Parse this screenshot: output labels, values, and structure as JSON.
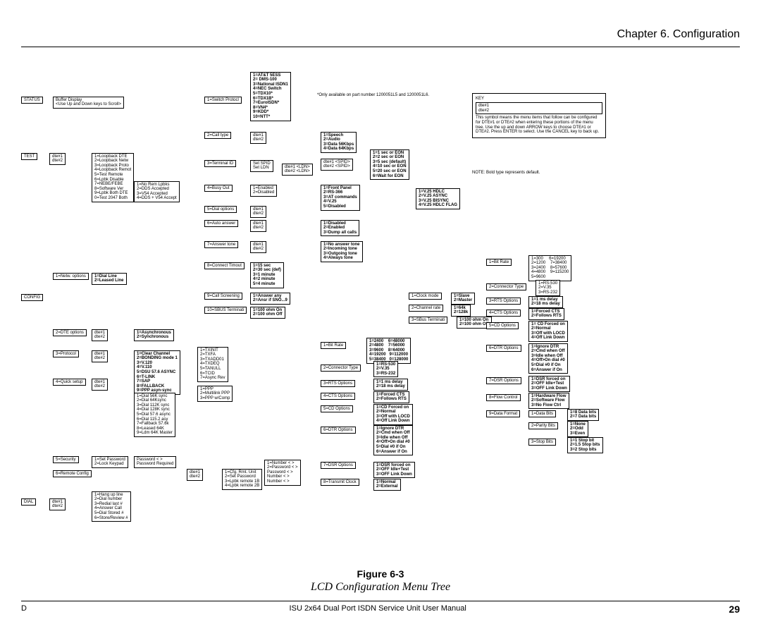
{
  "chapter": "Chapter 6. Configuration",
  "figure_label": "Figure 6-3",
  "figure_caption": "LCD Configuration Menu Tree",
  "footer_left": "D",
  "footer_mid": "ISU 2x64 Dual Port ISDN Service Unit User Manual",
  "page_num": "29",
  "key_title": "KEY",
  "key_dte1": "dte#1",
  "key_dte2": "dte#2",
  "key_text": "This symbol means the menu items that follow can be configured for DTE#1 or DTE#2 when entering these portions of the menu tree. Use the up and down ARROW keys to choose DTE#1 or DTE#2. Press ENTER to select. Use the CANCEL key to back up.",
  "note_bold": "NOTE: Bold type represents default.",
  "star_note": "*Only available on part number 1200051L5 and 1200051L6.",
  "status": "STATUS",
  "status_buffer": "Buffer Display\n<Use Up and Down keys to Scroll>",
  "test": "TEST",
  "test_dte": "dte#1\ndte#2",
  "test_loop": "1=Loopback DTE\n2=Loopback Netw\n3=Loopback Proto\n4=Loopback Remot\n5=Test Remote\n6=Lpbk Disable\n7=NEBE/FEBE\n8=Software Ver\n9=Lpbk Both DTE\n0=Test 2047 Both",
  "test_rem": "1=No Rem Lpbks\n2=DDS Accepted\n3=V54 Accepted\n4=DDS + V54 Accept",
  "config": "CONFIG",
  "netw_opt": "1=Netw. options",
  "netw_line": "1=Dial Line\n2=Leased Line",
  "sw_protocol": "1=Switch Protocl",
  "sw_list": "1=AT&T 5ESS\n2= DMS-100\n3=National ISDN1\n4=NEC Switch\n5=TDX10*\n6=TDX1B*\n7=EuroISDN*\n8=VN4*\n9=KDD*\n10=NTT*",
  "call_type": "2=Call type",
  "call_dte": "dte#1\ndte#2",
  "call_list": "1=Speech\n2=Audio\n3=Data 56Kbps\n4=Data 64Kbps",
  "eon": "1=1 sec or EON\n2=2 sec or EON\n3=5 sec (default)\n4=10 sec or EON\n5=20 sec or EON\n6=Wait for EON",
  "term_id": "3=Terminal ID",
  "term_spid": "Set SPID\nSet LDN",
  "term_dte": "dte#1 <LDN>\ndte#2 <LDN>",
  "term_spid2": "dte#1 <SPID>\ndte#2 <SPID>",
  "busy": "4=Busy Out",
  "busy_list": "1=Enabled\n2=Disabled",
  "front": "1=Front Panel\n2=RS-366\n3=AT commands\n4=V.25\n5=Disabled",
  "hdlc": "1=V.25 HDLC\n2=V.25 ASYNC\n3=V.25 BISYNC\n4=V.25 HDLC FLAG",
  "dial_opt": "5=Dial options",
  "dial_dte": "dte#1\ndte#2",
  "auto_ans": "6=Auto answer",
  "auto_dte": "dte#1\ndte#2",
  "auto_list": "1=Disabled\n2=Enabled\n3=Dump all calls",
  "ans_tone": "7=Answer tone",
  "ans_dte": "dte#1\ndte#2",
  "ans_list": "1=No answer tone\n2=Incoming tone\n3=Outgoing tone\n4=Always tone",
  "conn_to": "8=Connect Timout",
  "conn_list": "1=15 sec\n2=30 sec (def)\n3=1 minute\n4=2 minute\n5=4 minute",
  "call_scr": "9=Call Screening",
  "call_scr_list": "1=Answer any\n2=Ansr if SNO...9",
  "sbus": "10=SBUS Terminati",
  "sbus_list": "1=100 ohm On\n2=100 ohm Off",
  "clock_mode": "1=Clock mode",
  "clock_list": "1=Slave\n2=Master",
  "chan_rate": "2=Channel rate",
  "chan_list": "1=64k\n2=128k",
  "sbus_term": "3=SBus Terminati",
  "sbus_term_list": "1=100 ohm On\n2=100 ohm Off",
  "dte_opt": "2=DTE options",
  "dte_dte": "dte#1\ndte#2",
  "sync": "1=Asynchronous\n2=Synchronous",
  "protocol": "3=Protocol",
  "proto_dte": "dte#1\ndte#2",
  "proto_list": "1=Clear Channel\n2=BONDING mode 1\n3=V.120\n4=V.110\n5=DSU 57.6 ASYNC\n6=T-LINK\n7=SAP\n8=FALLBACK\n9=PPP asyn-sync",
  "proto_tx": "1=TXINIT\n2=TXFA\n3=TXADD01\n4=TXDEQ\n5=TANULL\n6=TCID\n7=Async Rev",
  "ppp": "1=PPP\n2=Multilink PPP\n3=PPP w/Comp",
  "quick": "4=Quick setup",
  "quick_dte": "dte#1\ndte#2",
  "quick_list": "1=Dial 56K sync\n2=Dial 64Ksync\n3=Dial 112K sync\n4=Dial 128K sync\n5=Dial 57.6 async\n6=Dial 115.2 asy\n7=Fallback 57.6k\n8=Leased 64K\n9=Ldm 64K Master",
  "security": "5=Security",
  "sec_list": "1=Set Password\n2=Lock Keypad",
  "sec_pwd": "Password < >\nPassword Required",
  "remote_cfg": "6=Remote Config",
  "rc_dte": "dte#1\ndte#2",
  "rc_list": "1=Cfg. Rmt. Unit\n2=Set Password\n3=Lpbk remote 1B\n4=Lpbk remote 2B",
  "rc_sub": "1=Number < >\n2=Password < >\nPassword < >\nNumber < >\nNumber < >",
  "dial": "DIAL",
  "dial_dte2": "dte#1\ndte#2",
  "dial_list": "1=Hang up line\n2=Dial number\n3=Redial last #\n4=Answer Call\n5=Dial Stored #\n6=Store/Review #",
  "bit_rate": "1=Bit Rate",
  "bit_list": "1=2400    6=48000\n2=4800    7=56000\n3=9600    8=64000\n4=19200   9=112000\n5=38400   0=128000",
  "conn_type": "2=Connector Type",
  "conn_list2": "1=RS-530\n2=V.35\n3=RS-232",
  "rts": "3=RTS Options",
  "rts_list": "1=1 ms delay\n2=18 ms delay",
  "cts": "4=CTS Options",
  "cts_list": "1=Forced CTS\n2=Follows RTS",
  "cd": "5=CD Options",
  "cd_list": "1=CD Forced on\n2=Normal\n3=Off with LOCD\n4=Off Link Down",
  "dtr": "6=DTR Options",
  "dtr_list": "1=Ignore DTR\n2=Cmd when Off\n3=Idle when Off\n4=Off>On dial #0\n5=Dial #0 if On\n6=Answer if On",
  "dsr": "7=DSR Options",
  "dsr_list": "1=DSR forced on\n2=OFF Idle+Test\n3=OFF Link Down",
  "trans_clk": "8=Transmit Clock",
  "trans_list": "1=Normal\n2=External",
  "bit_rate2": "1=Bit Rate",
  "bit_list2": "1=300     6=19200\n2=1200    7=38400\n3=2400    8=57600\n4=4800    9=115200\n5=9600",
  "conn_type2": "2=Connector Type",
  "conn_list3": "1=RS-530\n2=V.35\n3=RS-232",
  "rts2": "3=RTS Options",
  "rts_list2": "1=1 ms delay\n2=18 ms delay",
  "cts2": "4=CTS Options",
  "cts_list2": "1=Forced CTS\n2=Follows RTS",
  "cd2": "5=CD Options",
  "cd_list2": "1= CD Forced on\n2=Normal\n3=Off with LOCD\n4=Off Link Down",
  "dtr2": "6=DTR Options",
  "dtr_list2": "1=Ignore DTR\n2=Cmd when Off\n3=Idle when Off\n4=Off>On dial #0\n5=Dial #0 if On\n6=Answer if On",
  "dsr2": "7=DSR Options",
  "dsr_list2": "1=DSR forced on\n2=OFF Idle+Test\n3=OFF Link Down",
  "flow": "8=Flow Control",
  "flow_list": "1=Hardware Flow\n2=Software Flow\n3=No Flow Ctrl",
  "data_fmt": "9=Data Format",
  "data_bits": "1=Data Bits",
  "data_bits_list": "1=8 Data bits\n2=7 Data bits",
  "parity": "2=Parity Bits",
  "parity_list": "1=None\n2=Odd\n3=Even",
  "stop": "3=Stop Bits",
  "stop_list": "1=1 Stop bit\n2=1.5 Stop bits\n3=2 Stop bits"
}
